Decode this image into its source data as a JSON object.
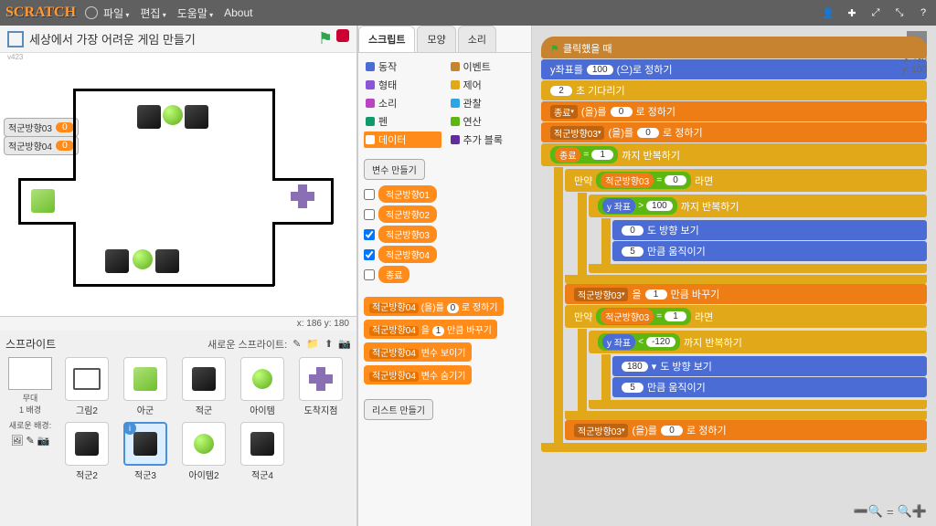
{
  "menubar": {
    "file": "파일",
    "edit": "편집",
    "help": "도움말",
    "about": "About"
  },
  "stage": {
    "title": "세상에서 가장 어려운 게임 만들기",
    "version": "v423",
    "var1_name": "적군방향03",
    "var1_val": "0",
    "var2_name": "적군방향04",
    "var2_val": "0",
    "coords": "x: 186  y: 180"
  },
  "sprite_panel": {
    "label": "스프라이트",
    "new_label": "새로운 스프라이트:",
    "stage_label": "무대",
    "stage_sub": "1 배경",
    "new_bg": "새로운 배경:",
    "sprites": [
      "그림2",
      "아군",
      "적군",
      "아이템",
      "도착지점",
      "적군2",
      "적군3",
      "아이템2",
      "적군4"
    ]
  },
  "tabs": {
    "t1": "스크립트",
    "t2": "모양",
    "t3": "소리"
  },
  "categories": {
    "motion": "동작",
    "looks": "형태",
    "sound": "소리",
    "pen": "펜",
    "data": "데이터",
    "events": "이벤트",
    "control": "제어",
    "sensing": "관찰",
    "operators": "연산",
    "more": "추가 블록"
  },
  "palette": {
    "make_var": "변수 만들기",
    "vars": [
      "적군방향01",
      "적군방향02",
      "적군방향03",
      "적군방향04",
      "종료"
    ],
    "block1_pre": "적군방향04",
    "block1_mid": "(을)를",
    "block1_num": "0",
    "block1_post": "로 정하기",
    "block2_pre": "적군방향04",
    "block2_mid": "을",
    "block2_num": "1",
    "block2_post": "만큼 바꾸기",
    "block3": "변수 보이기",
    "block4": "변수 숨기기",
    "make_list": "리스트 만들기"
  },
  "script": {
    "hat": "클릭했을 때",
    "l1_pre": "y좌표를",
    "l1_num": "100",
    "l1_post": "(으)로 정하기",
    "l2_num": "2",
    "l2_post": "초 기다리기",
    "l3_var": "종료",
    "l3_mid": "(을)를",
    "l3_num": "0",
    "l3_post": "로 정하기",
    "l4_var": "적군방향03",
    "l4_mid": "(을)를",
    "l4_num": "0",
    "l4_post": "로 정하기",
    "l5_pre": "",
    "l5_var": "종료",
    "l5_op": "=",
    "l5_num": "1",
    "l5_post": "까지 반복하기",
    "l6_pre": "만약",
    "l6_var": "적군방향03",
    "l6_op": "=",
    "l6_num": "0",
    "l6_post": "라면",
    "l7_var": "y 좌표",
    "l7_op": ">",
    "l7_num": "100",
    "l7_post": "까지 반복하기",
    "l8_num": "0",
    "l8_post": "도 방향 보기",
    "l9_num": "5",
    "l9_post": "만큼 움직이기",
    "l10_var": "적군방향03",
    "l10_mid": "을",
    "l10_num": "1",
    "l10_post": "만큼 바꾸기",
    "l11_pre": "만약",
    "l11_var": "적군방향03",
    "l11_op": "=",
    "l11_num": "1",
    "l11_post": "라면",
    "l12_var": "y 좌표",
    "l12_op": "<",
    "l12_num": "-120",
    "l12_post": "까지 반복하기",
    "l13_num": "180",
    "l13_post": "도 방향 보기",
    "l14_num": "5",
    "l14_post": "만큼 움직이기",
    "l15_var": "적군방향03",
    "l15_mid": "(을)를",
    "l15_num": "0",
    "l15_post": "로 정하기"
  },
  "right_info": {
    "x": "x: -30",
    "y": "y: 100"
  }
}
